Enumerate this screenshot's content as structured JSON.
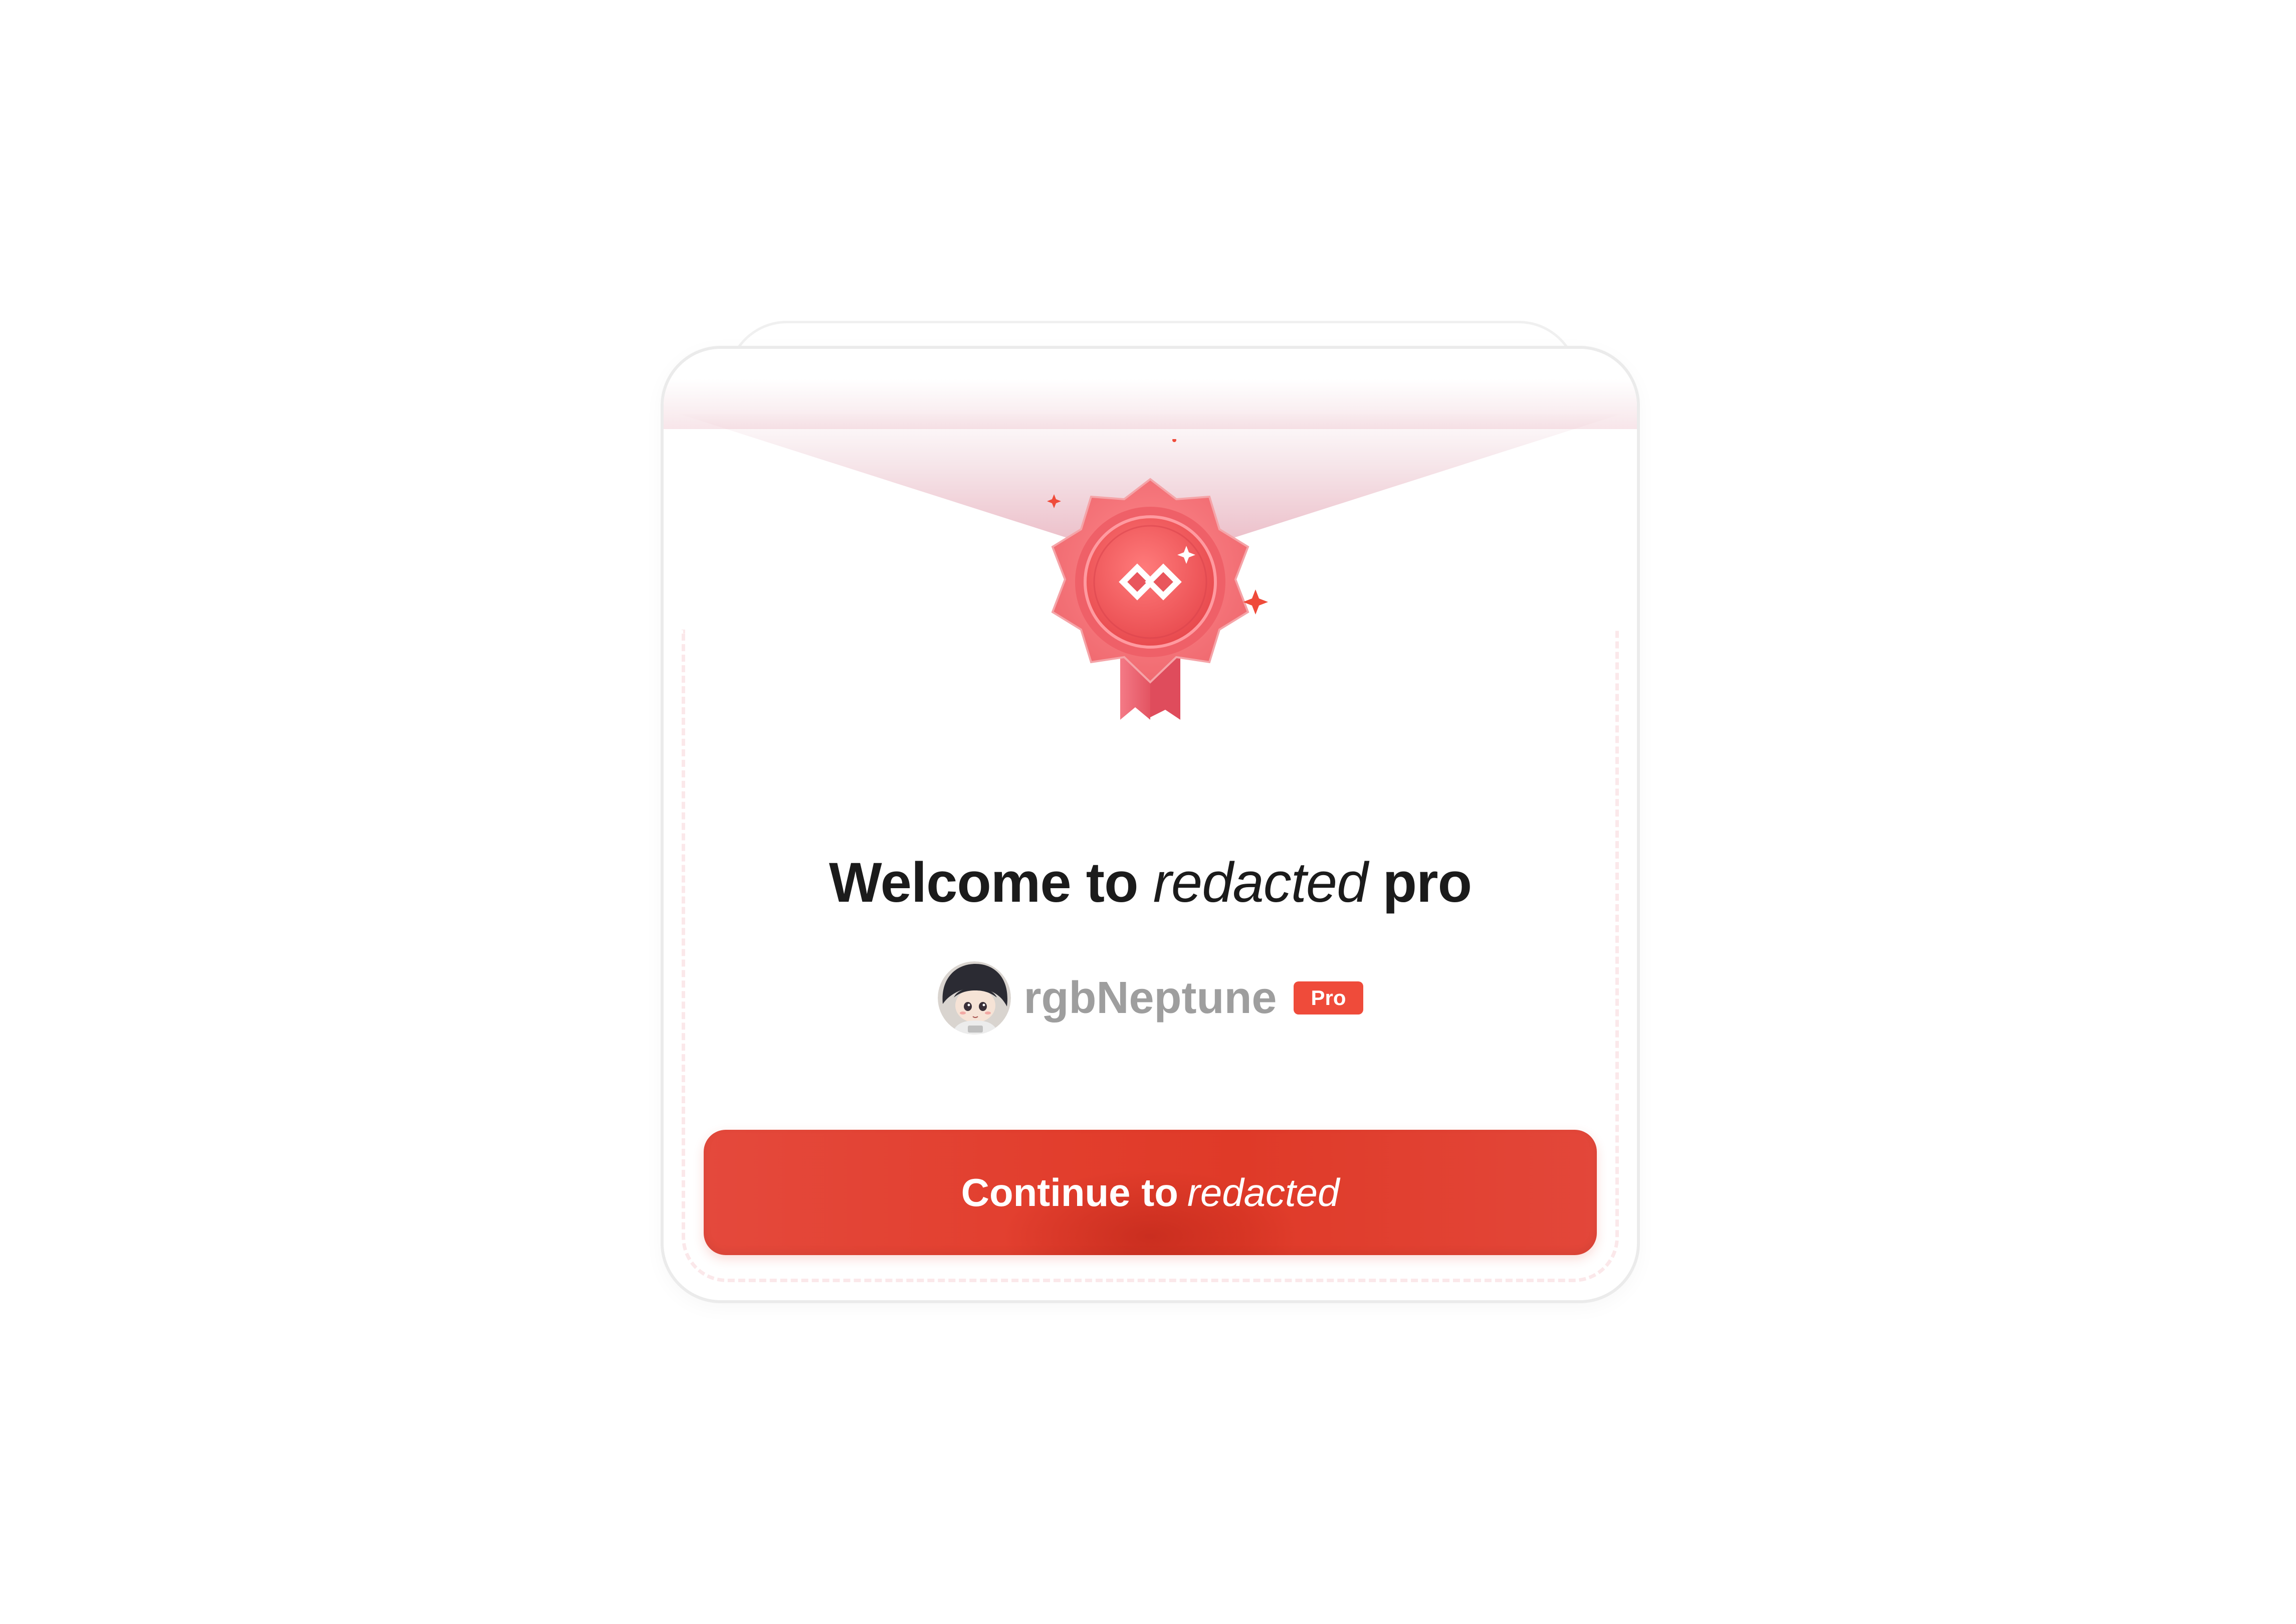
{
  "welcome": {
    "title_prefix": "Welcome to",
    "title_brand": "redacted",
    "title_suffix": "pro"
  },
  "user": {
    "username": "rgbNeptune",
    "plan_badge": "Pro"
  },
  "cta": {
    "label_prefix": "Continue to",
    "label_brand": "redacted"
  },
  "colors": {
    "accent": "#ef4b3a",
    "button": "#e23e2d",
    "title_text": "#1b1b1b",
    "username_text": "#9e9e9e",
    "badge_ring": "#f06a6e"
  },
  "icons": {
    "badge": "award-medal-icon",
    "logo": "diamond-logo-icon",
    "sparkle": "sparkle-icon"
  }
}
